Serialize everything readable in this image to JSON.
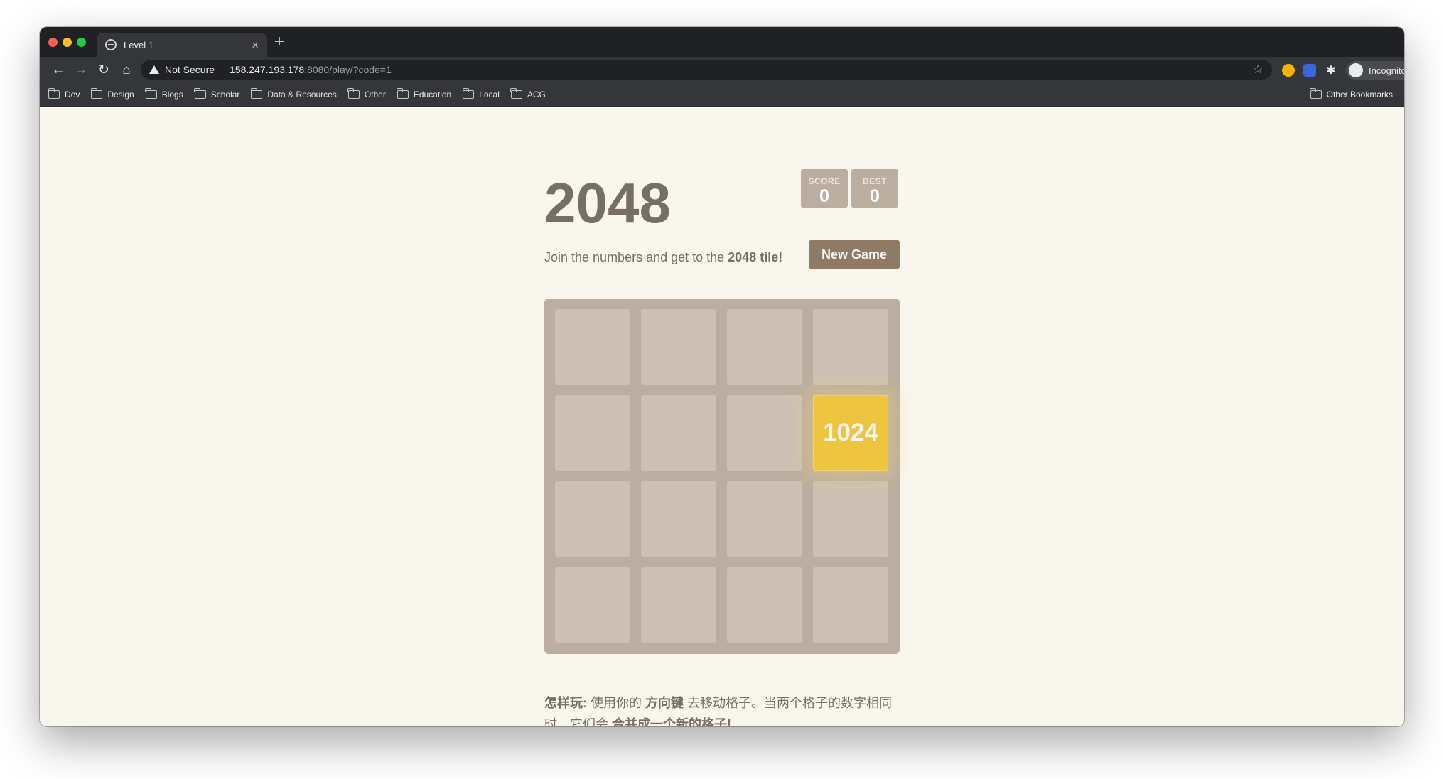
{
  "browser": {
    "tab_title": "Level 1",
    "tab_close": "×",
    "new_tab": "+",
    "not_secure": "Not Secure",
    "url_host": "158.247.193.178",
    "url_path": ":8080/play/?code=1",
    "profile": "Incognito",
    "bookmarks": [
      "Dev",
      "Design",
      "Blogs",
      "Scholar",
      "Data & Resources",
      "Other",
      "Education",
      "Local",
      "ACG"
    ],
    "other_bookmarks": "Other Bookmarks"
  },
  "game": {
    "title": "2048",
    "score_label": "SCORE",
    "score_value": "0",
    "best_label": "BEST",
    "best_value": "0",
    "intro_prefix": "Join the numbers and get to the ",
    "intro_bold": "2048 tile!",
    "new_game_label": "New Game",
    "grid_size": 4,
    "tiles": [
      {
        "value": "1024",
        "row": 1,
        "col": 3,
        "color": "#edc53f"
      }
    ],
    "board_color": "#bbada0",
    "background_color": "#f9f6ee",
    "how_to": {
      "label": "怎样玩:",
      "text1": " 使用你的 ",
      "keys": "方向键",
      "text2": " 去移动格子。当两个格子的数字相同时，它们会 ",
      "merge": "合并成一个新的格子!"
    }
  }
}
